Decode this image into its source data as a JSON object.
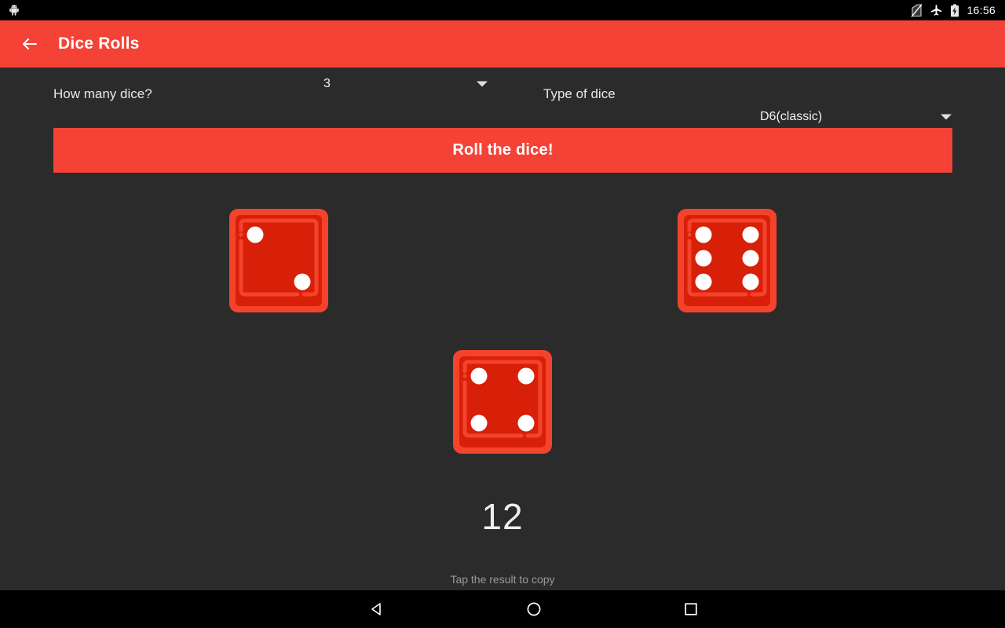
{
  "status_bar": {
    "time": "16:56",
    "icons": [
      "no-sim-icon",
      "airplane-mode-icon",
      "battery-charging-icon"
    ],
    "background": "#000000"
  },
  "app_bar": {
    "title": "Dice Rolls",
    "back_icon": "arrow-back-icon",
    "background": "#f44336",
    "text_color": "#ffffff"
  },
  "options": {
    "dice_count": {
      "label": "How many dice?",
      "value": "3",
      "caret_icon": "chevron-down-icon"
    },
    "dice_type": {
      "label": "Type of dice",
      "value": "D6(classic)",
      "caret_icon": "chevron-down-icon"
    }
  },
  "roll_button": {
    "label": "Roll the dice!",
    "background": "#f44336"
  },
  "dice": {
    "face_color": "#d81f08",
    "border_color": "#f4432c",
    "pip_color": "#ffffff",
    "results": [
      {
        "name": "die-1",
        "value": 2,
        "pips": [
          1,
          0,
          0,
          0,
          0,
          0,
          0,
          0,
          1
        ]
      },
      {
        "name": "die-2",
        "value": 6,
        "pips": [
          1,
          0,
          1,
          1,
          0,
          1,
          1,
          0,
          1
        ]
      },
      {
        "name": "die-3",
        "value": 4,
        "pips": [
          1,
          0,
          1,
          0,
          0,
          0,
          1,
          0,
          1
        ]
      }
    ]
  },
  "result": {
    "total": "12",
    "hint": "Tap the result to copy"
  },
  "nav_bar": {
    "back_icon": "nav-back-triangle-icon",
    "home_icon": "nav-home-circle-icon",
    "recents_icon": "nav-recents-square-icon",
    "background": "#000000"
  }
}
